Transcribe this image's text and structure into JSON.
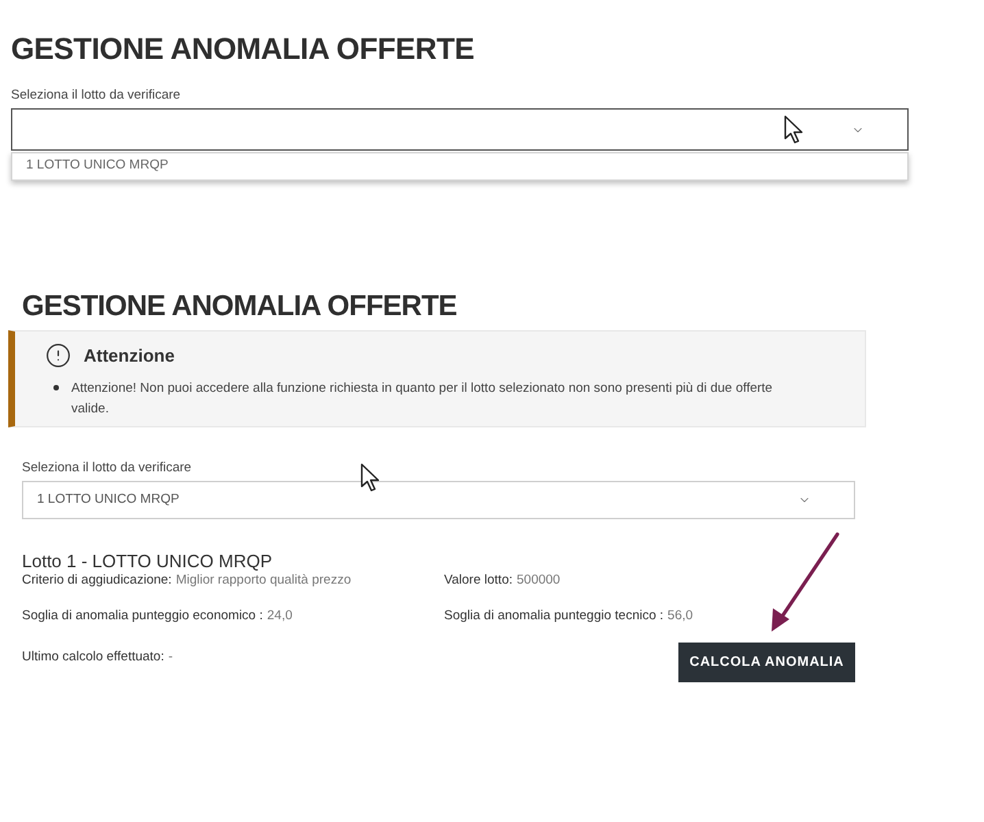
{
  "dropdown_view": {
    "title": "GESTIONE ANOMALIA OFFERTE",
    "select": {
      "label": "Seleziona il lotto da verificare",
      "expanded": true,
      "options": [
        {
          "label": "1 LOTTO UNICO MRQP",
          "selected": false
        }
      ]
    }
  },
  "result_view": {
    "title": "GESTIONE ANOMALIA OFFERTE",
    "alert": {
      "title": "Attenzione",
      "messages": [
        "Attenzione! Non puoi accedere alla funzione richiesta in quanto per il lotto selezionato non sono presenti più di due offerte valide."
      ]
    },
    "select": {
      "label": "Seleziona il lotto da verificare",
      "value": "1 LOTTO UNICO MRQP",
      "expanded": false
    },
    "lot": {
      "heading": "Lotto 1 - LOTTO UNICO MRQP",
      "fields": [
        {
          "label": "Criterio di aggiudicazione:",
          "value": "Miglior rapporto qualità prezzo"
        },
        {
          "label": "Valore lotto:",
          "value": "500000"
        },
        {
          "label": "Soglia di anomalia punteggio economico :",
          "value": "24,0"
        },
        {
          "label": "Soglia di anomalia punteggio tecnico :",
          "value": "56,0"
        }
      ],
      "last_calc": {
        "label": "Ultimo calcolo effettuato:",
        "value": "-"
      },
      "button": "CALCOLA ANOMALIA"
    }
  }
}
